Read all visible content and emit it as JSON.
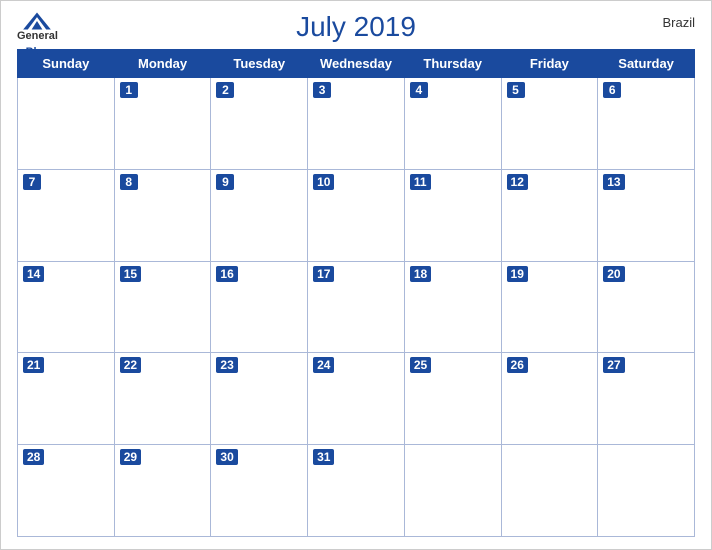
{
  "header": {
    "title": "July 2019",
    "country": "Brazil",
    "logo": {
      "line1": "General",
      "line2": "Blue"
    }
  },
  "calendar": {
    "weekdays": [
      "Sunday",
      "Monday",
      "Tuesday",
      "Wednesday",
      "Thursday",
      "Friday",
      "Saturday"
    ],
    "weeks": [
      [
        null,
        1,
        2,
        3,
        4,
        5,
        6
      ],
      [
        7,
        8,
        9,
        10,
        11,
        12,
        13
      ],
      [
        14,
        15,
        16,
        17,
        18,
        19,
        20
      ],
      [
        21,
        22,
        23,
        24,
        25,
        26,
        27
      ],
      [
        28,
        29,
        30,
        31,
        null,
        null,
        null
      ]
    ]
  }
}
